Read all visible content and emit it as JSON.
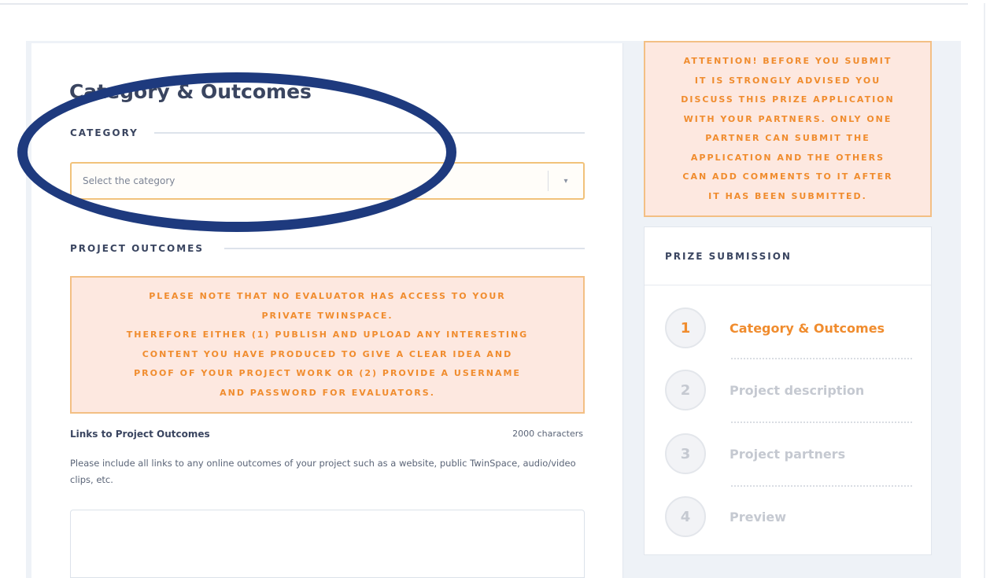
{
  "form": {
    "section_title": "Category & Outcomes",
    "category_label": "CATEGORY",
    "category_select": {
      "placeholder": "Select the category",
      "arrow": "▾"
    },
    "outcomes_label": "PROJECT OUTCOMES",
    "outcomes_warning": [
      "PLEASE NOTE THAT NO EVALUATOR HAS ACCESS TO YOUR",
      "PRIVATE TWINSPACE.",
      "THEREFORE EITHER (1) PUBLISH AND UPLOAD ANY INTERESTING",
      "CONTENT YOU HAVE PRODUCED TO GIVE A CLEAR IDEA AND",
      "PROOF OF YOUR PROJECT WORK OR (2) PROVIDE A USERNAME",
      "AND PASSWORD FOR EVALUATORS."
    ],
    "links_label": "Links to Project Outcomes",
    "char_limit": "2000 characters",
    "links_help": "Please include all links to any online outcomes of your project such as a website, public TwinSpace, audio/video clips, etc.",
    "links_value": ""
  },
  "sidebar": {
    "attention_warning": [
      "ATTENTION! BEFORE YOU SUBMIT",
      "IT IS STRONGLY ADVISED YOU",
      "DISCUSS THIS PRIZE APPLICATION",
      "WITH YOUR PARTNERS. ONLY ONE",
      "PARTNER CAN SUBMIT THE",
      "APPLICATION AND THE OTHERS",
      "CAN ADD COMMENTS TO IT AFTER",
      "IT HAS BEEN SUBMITTED."
    ],
    "submission_title": "PRIZE SUBMISSION",
    "steps": [
      {
        "number": "1",
        "label": "Category & Outcomes",
        "active": true
      },
      {
        "number": "2",
        "label": "Project description",
        "active": false
      },
      {
        "number": "3",
        "label": "Project partners",
        "active": false
      },
      {
        "number": "4",
        "label": "Preview",
        "active": false
      }
    ]
  },
  "colors": {
    "accent_orange": "#f08c2e",
    "highlight_ellipse": "#1e3a7e",
    "warning_bg": "#fde8e0"
  }
}
